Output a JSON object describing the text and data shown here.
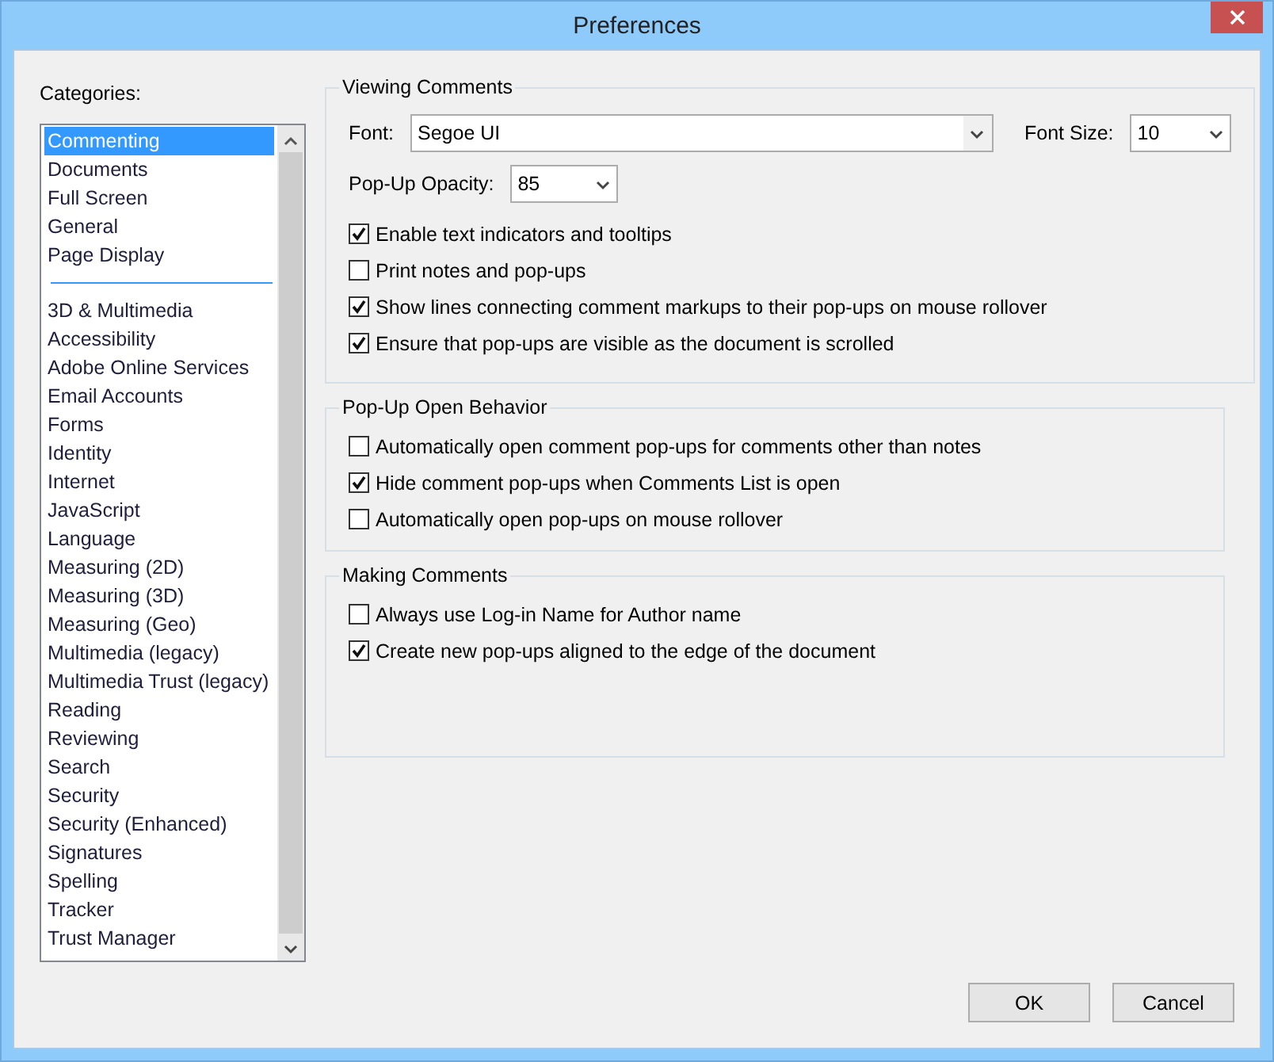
{
  "window": {
    "title": "Preferences"
  },
  "categories": {
    "label": "Categories:",
    "groups": [
      {
        "items": [
          {
            "label": "Commenting",
            "selected": true
          },
          {
            "label": "Documents",
            "selected": false
          },
          {
            "label": "Full Screen",
            "selected": false
          },
          {
            "label": "General",
            "selected": false
          },
          {
            "label": "Page Display",
            "selected": false
          }
        ]
      },
      {
        "items": [
          {
            "label": "3D & Multimedia",
            "selected": false
          },
          {
            "label": "Accessibility",
            "selected": false
          },
          {
            "label": "Adobe Online Services",
            "selected": false
          },
          {
            "label": "Email Accounts",
            "selected": false
          },
          {
            "label": "Forms",
            "selected": false
          },
          {
            "label": "Identity",
            "selected": false
          },
          {
            "label": "Internet",
            "selected": false
          },
          {
            "label": "JavaScript",
            "selected": false
          },
          {
            "label": "Language",
            "selected": false
          },
          {
            "label": "Measuring (2D)",
            "selected": false
          },
          {
            "label": "Measuring (3D)",
            "selected": false
          },
          {
            "label": "Measuring (Geo)",
            "selected": false
          },
          {
            "label": "Multimedia (legacy)",
            "selected": false
          },
          {
            "label": "Multimedia Trust (legacy)",
            "selected": false
          },
          {
            "label": "Reading",
            "selected": false
          },
          {
            "label": "Reviewing",
            "selected": false
          },
          {
            "label": "Search",
            "selected": false
          },
          {
            "label": "Security",
            "selected": false
          },
          {
            "label": "Security (Enhanced)",
            "selected": false
          },
          {
            "label": "Signatures",
            "selected": false
          },
          {
            "label": "Spelling",
            "selected": false
          },
          {
            "label": "Tracker",
            "selected": false
          },
          {
            "label": "Trust Manager",
            "selected": false
          }
        ]
      }
    ]
  },
  "groups": [
    {
      "title": "Viewing Comments",
      "kind": "viewing",
      "font": {
        "label": "Font:",
        "value": "Segoe UI"
      },
      "font_size": {
        "label": "Font Size:",
        "value": "10"
      },
      "opacity": {
        "label": "Pop-Up Opacity:",
        "value": "85"
      },
      "options": [
        {
          "label": "Enable text indicators and tooltips",
          "checked": true
        },
        {
          "label": "Print notes and pop-ups",
          "checked": false
        },
        {
          "label": "Show lines connecting comment markups to their pop-ups on mouse rollover",
          "checked": true
        },
        {
          "label": "Ensure that pop-ups are visible as the document is scrolled",
          "checked": true
        }
      ]
    },
    {
      "title": "Pop-Up Open Behavior",
      "kind": "plain",
      "options": [
        {
          "label": "Automatically open comment pop-ups for comments other than notes",
          "checked": false
        },
        {
          "label": "Hide comment pop-ups when Comments List is open",
          "checked": true
        },
        {
          "label": "Automatically open pop-ups on mouse rollover",
          "checked": false
        }
      ]
    },
    {
      "title": "Making Comments",
      "kind": "plain",
      "options": [
        {
          "label": "Always use Log-in Name for Author name",
          "checked": false
        },
        {
          "label": "Create new pop-ups aligned to the edge of the document",
          "checked": true
        }
      ]
    }
  ],
  "buttons": [
    {
      "label": "OK"
    },
    {
      "label": "Cancel"
    }
  ]
}
